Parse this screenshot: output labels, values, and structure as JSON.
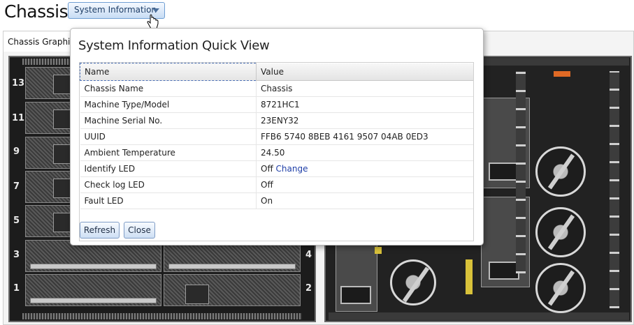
{
  "header": {
    "title": "Chassis",
    "system_info_button": "System Information"
  },
  "tab": {
    "label": "Chassis Graphical View"
  },
  "front_bays": {
    "left": [
      "13",
      "11",
      "9",
      "7",
      "5",
      "3",
      "1"
    ],
    "right": [
      "4",
      "2"
    ]
  },
  "dialog": {
    "title": "System Information Quick View",
    "columns": [
      "Name",
      "Value"
    ],
    "rows": [
      {
        "name": "Chassis Name",
        "value": "Chassis"
      },
      {
        "name": "Machine Type/Model",
        "value": "8721HC1"
      },
      {
        "name": "Machine Serial No.",
        "value": "23ENY32"
      },
      {
        "name": "UUID",
        "value": "FFB6 5740 8BEB 4161 9507 04AB 0ED3"
      },
      {
        "name": "Ambient Temperature",
        "value": "24.50"
      },
      {
        "name": "Identify LED",
        "value": "Off",
        "link": "Change"
      },
      {
        "name": "Check log LED",
        "value": "Off"
      },
      {
        "name": "Fault LED",
        "value": "On"
      }
    ],
    "refresh_label": "Refresh",
    "close_label": "Close"
  },
  "colors": {
    "accent": "#6f9ed3",
    "link": "#1f3fa8",
    "orange": "#e06a25"
  }
}
